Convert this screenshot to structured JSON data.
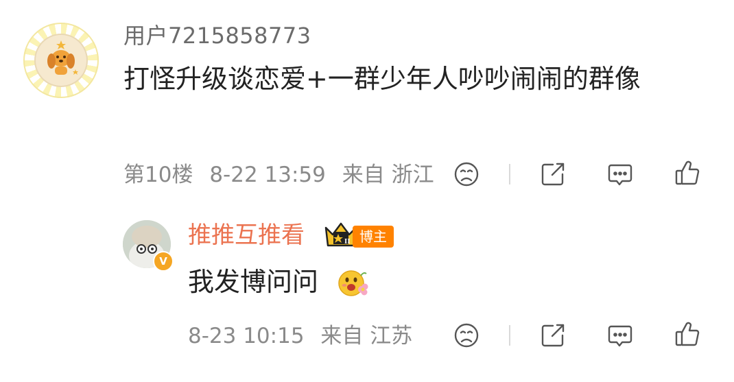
{
  "comment": {
    "username": "用户7215858773",
    "text": "打怪升级谈恋爱+一群少年人吵吵闹闹的群像",
    "floor": "第10楼",
    "time": "8-22 13:59",
    "location": "来自 浙江"
  },
  "reply": {
    "username": "推推互推看",
    "badge": "博主",
    "text": "我发博问问",
    "time": "8-23 10:15",
    "location": "来自 江苏"
  },
  "actions": [
    "dislike-icon",
    "share-icon",
    "comment-icon",
    "like-icon"
  ],
  "colors": {
    "reply_name": "#eb7350",
    "meta_text": "#8a8a8a",
    "badge_orange": "#ff8200"
  }
}
